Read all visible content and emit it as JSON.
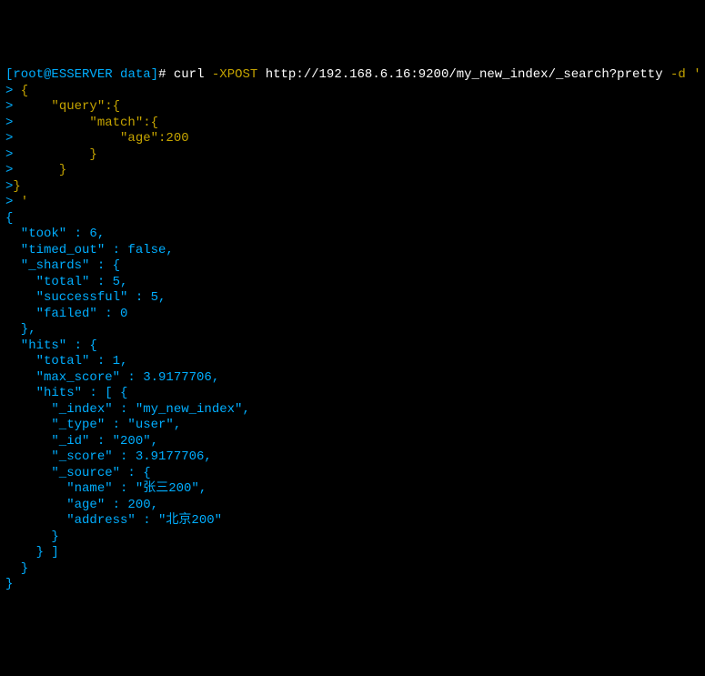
{
  "prompt": {
    "open_bracket": "[",
    "user": "root",
    "at": "@",
    "host": "ESSERVER",
    "space": " ",
    "path": "data",
    "close_bracket": "]",
    "symbol": "#"
  },
  "command": {
    "curl": "curl",
    "flag1": "-XPOST",
    "url": "http://192.168.6.16:9200/my_new_index/_search?pretty",
    "flag2": "-d",
    "quote": "'"
  },
  "input_lines": {
    "l1": ">",
    "l1b": " {",
    "l2": ">",
    "l2b": "     \"query\":{",
    "l3": ">",
    "l3b": "          \"match\":{",
    "l4": ">",
    "l4b": "              \"age\":200",
    "l5": ">",
    "l5b": "          }",
    "l6": ">",
    "l6b": "      }",
    "l7": ">",
    "l7b": "}",
    "l8": ">",
    "l8b": " '"
  },
  "response": {
    "r01": "{",
    "r02": "  \"took\" : 6,",
    "r03": "  \"timed_out\" : false,",
    "r04": "  \"_shards\" : {",
    "r05": "    \"total\" : 5,",
    "r06": "    \"successful\" : 5,",
    "r07": "    \"failed\" : 0",
    "r08": "  },",
    "r09": "  \"hits\" : {",
    "r10": "    \"total\" : 1,",
    "r11": "    \"max_score\" : 3.9177706,",
    "r12": "    \"hits\" : [ {",
    "r13": "      \"_index\" : \"my_new_index\",",
    "r14": "      \"_type\" : \"user\",",
    "r15": "      \"_id\" : \"200\",",
    "r16": "      \"_score\" : 3.9177706,",
    "r17": "      \"_source\" : {",
    "r18": "        \"name\" : \"张三200\",",
    "r19": "        \"age\" : 200,",
    "r20": "        \"address\" : \"北京200\"",
    "r21": "      }",
    "r22": "    } ]",
    "r23": "  }",
    "r24": "}"
  }
}
